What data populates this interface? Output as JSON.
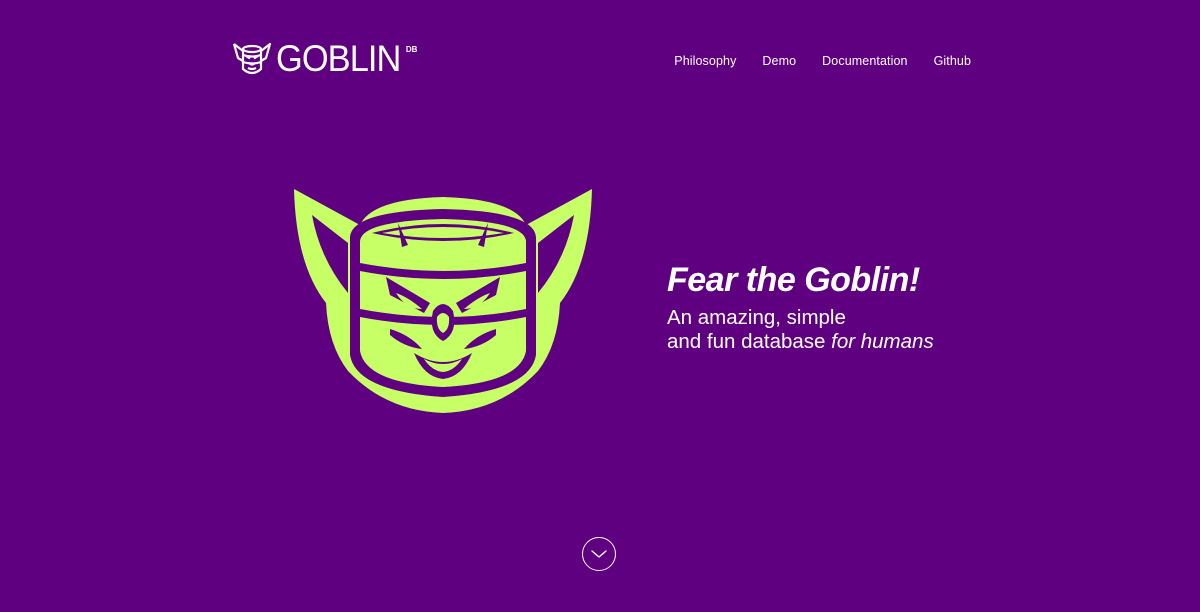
{
  "brand": {
    "name": "GOBLIN",
    "superscript": "DB",
    "logo_icon": "goblin-head-icon"
  },
  "nav": {
    "items": [
      {
        "label": "Philosophy"
      },
      {
        "label": "Demo"
      },
      {
        "label": "Documentation"
      },
      {
        "label": "Github"
      }
    ]
  },
  "hero": {
    "title": "Fear the Goblin!",
    "subtitle_line1": "An amazing, simple",
    "subtitle_line2_plain": "and fun database ",
    "subtitle_line2_em": "for humans",
    "mascot_icon": "goblin-database-mascot-icon",
    "scroll_icon": "chevron-down-icon"
  },
  "colors": {
    "background": "#5e0080",
    "accent": "#c6ff66",
    "text": "#ffffff"
  }
}
